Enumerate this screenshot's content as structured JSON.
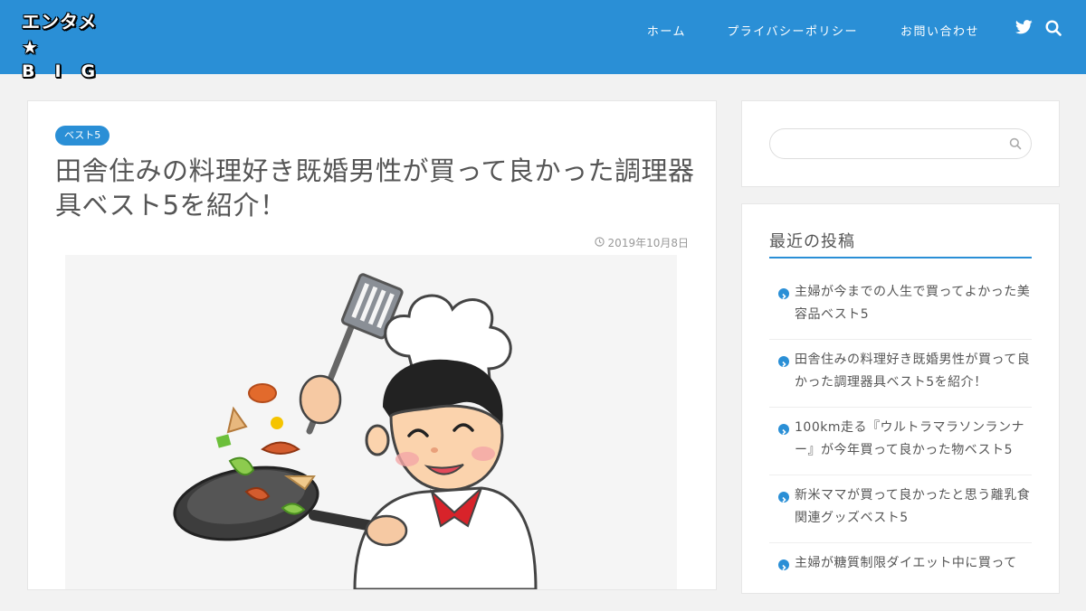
{
  "header": {
    "logo_line1": "エンタメ★",
    "logo_line2": "BIG",
    "nav": [
      "ホーム",
      "プライバシーポリシー",
      "お問い合わせ"
    ]
  },
  "article": {
    "category": "ベスト5",
    "title": "田舎住みの料理好き既婚男性が買って良かった調理器具ベスト5を紹介！",
    "date": "2019年10月8日"
  },
  "sidebar": {
    "search_placeholder": "",
    "recent_heading": "最近の投稿",
    "recent_posts": [
      "主婦が今までの人生で買ってよかった美容品ベスト5",
      "田舎住みの料理好き既婚男性が買って良かった調理器具ベスト5を紹介！",
      "100km走る『ウルトラマラソンランナー』が今年買って良かった物ベスト5",
      "新米ママが買って良かったと思う離乳食関連グッズベスト5",
      "主婦が糖質制限ダイエット中に買って"
    ]
  },
  "colors": {
    "accent": "#2a8fd6",
    "background": "#f2f2f2"
  },
  "icons": [
    "twitter-icon",
    "search-icon",
    "clock-icon",
    "chevron-right-icon"
  ]
}
